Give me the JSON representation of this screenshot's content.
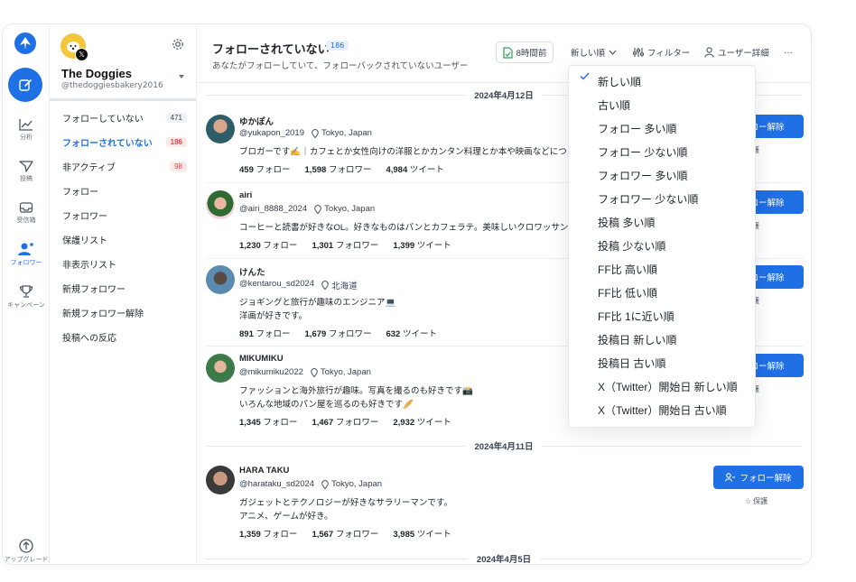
{
  "rail": {
    "nav": [
      {
        "label": "分析",
        "icon": "chart-icon"
      },
      {
        "label": "投稿",
        "icon": "send-icon"
      },
      {
        "label": "受信箱",
        "icon": "inbox-icon"
      },
      {
        "label": "フォロワー",
        "icon": "users-icon"
      },
      {
        "label": "キャンペーン",
        "icon": "trophy-icon"
      }
    ],
    "upgrade": "アップグレード"
  },
  "account": {
    "name": "The Doggies",
    "handle": "@thedoggiesbakery2016"
  },
  "sidebar": {
    "items": [
      {
        "label": "フォローしていない",
        "count": "471"
      },
      {
        "label": "フォローされていない",
        "count": "186"
      },
      {
        "label": "非アクティブ",
        "count": "98"
      },
      {
        "label": "フォロー"
      },
      {
        "label": "フォロワー"
      },
      {
        "label": "保護リスト"
      },
      {
        "label": "非表示リスト"
      },
      {
        "label": "新規フォロワー"
      },
      {
        "label": "新規フォロワー解除"
      },
      {
        "label": "投稿への反応"
      }
    ]
  },
  "header": {
    "title": "フォローされていない",
    "count": "186",
    "subtitle": "あなたがフォローしていて、フォローバックされていないユーザー",
    "time_label": "8時間前",
    "sort_label": "新しい順",
    "filter_label": "フィルター",
    "user_detail_label": "ユーザー詳細",
    "more": "···"
  },
  "dates": [
    "2024年4月12日",
    "2024年4月11日",
    "2024年4月5日"
  ],
  "users": [
    {
      "name": "ゆかぽん",
      "handle": "@yukapon_2019",
      "location": "Tokyo, Japan",
      "bio": [
        "ブロガーです✍️｜カフェとか女性向けの洋服とかカンタン料理とか本や映画などについ"
      ],
      "following": "459",
      "followers": "1,598",
      "tweets": "4,984"
    },
    {
      "name": "airi",
      "handle": "@airi_8888_2024",
      "location": "Tokyo, Japan",
      "bio": [
        " コーヒーと読書が好きなOL。好きなものはパンとカフェラテ。美味しいクロワッサンを"
      ],
      "following": "1,230",
      "followers": "1,301",
      "tweets": "1,399"
    },
    {
      "name": "けんた",
      "handle": "@kentarou_sd2024",
      "location": "北海道",
      "bio": [
        "ジョギングと旅行が趣味のエンジニア💻",
        "洋画が好きです。"
      ],
      "following": "891",
      "followers": "1,679",
      "tweets": "632"
    },
    {
      "name": "MIKUMIKU",
      "handle": "@mikumiku2022",
      "location": "Tokyo, Japan",
      "bio": [
        "ファッションと海外旅行が趣味。写真を撮るのも好きです📸",
        "いろんな地域のパン屋を巡るのも好きです🥖"
      ],
      "following": "1,345",
      "followers": "1,467",
      "tweets": "2,932"
    },
    {
      "name": "HARA TAKU",
      "handle": "@harataku_sd2024",
      "location": "Tokyo, Japan",
      "bio": [
        "ガジェットとテクノロジーが好きなサラリーマンです。",
        "アニメ、ゲームが好き。"
      ],
      "following": "1,359",
      "followers": "1,567",
      "tweets": "3,985"
    }
  ],
  "labels": {
    "following": "フォロー",
    "followers": "フォロワー",
    "tweets": "ツイート",
    "unfollow": "フォロー解除",
    "unfollow_partial": "ロー解除",
    "protect": "保護"
  },
  "sort_menu": {
    "selected_index": 0,
    "options": [
      "新しい順",
      "古い順",
      "フォロー 多い順",
      "フォロー 少ない順",
      "フォロワー 多い順",
      "フォロワー 少ない順",
      "投稿 多い順",
      "投稿 少ない順",
      "FF比 高い順",
      "FF比 低い順",
      "FF比 1に近い順",
      "投稿日 新しい順",
      "投稿日 古い順",
      "X（Twitter）開始日 新しい順",
      "X（Twitter）開始日 古い順"
    ]
  },
  "colors": {
    "accent": "#1f6fe5",
    "badge_red": "#e5484d"
  }
}
